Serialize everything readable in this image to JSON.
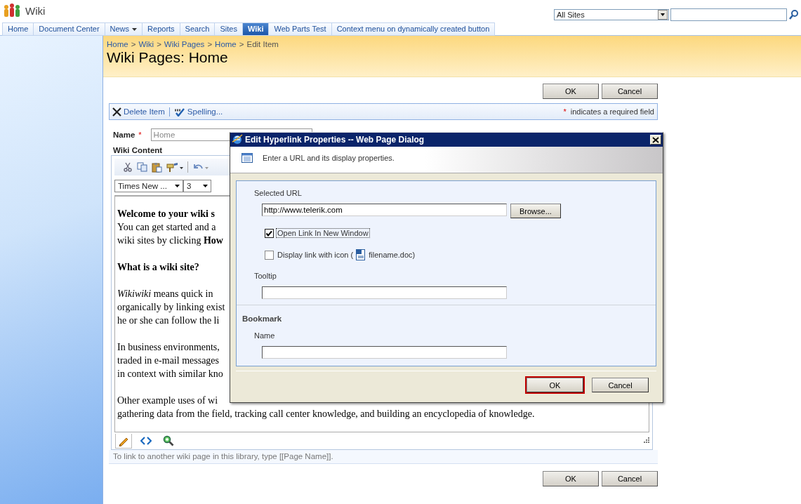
{
  "site": {
    "title": "Wiki"
  },
  "search": {
    "scope": "All Sites"
  },
  "nav_tabs": [
    {
      "label": "Home",
      "selected": false,
      "has_menu": false
    },
    {
      "label": "Document Center",
      "selected": false,
      "has_menu": false
    },
    {
      "label": "News",
      "selected": false,
      "has_menu": true
    },
    {
      "label": "Reports",
      "selected": false,
      "has_menu": false
    },
    {
      "label": "Search",
      "selected": false,
      "has_menu": false
    },
    {
      "label": "Sites",
      "selected": false,
      "has_menu": false
    },
    {
      "label": "Wiki",
      "selected": true,
      "has_menu": false
    },
    {
      "label": "Web Parts Test",
      "selected": false,
      "has_menu": false
    },
    {
      "label": "Context menu on dynamically created button",
      "selected": false,
      "has_menu": false
    }
  ],
  "breadcrumb": {
    "separator": ">",
    "items": [
      "Home",
      "Wiki",
      "Wiki Pages",
      "Home",
      "Edit Item"
    ]
  },
  "page_title": "Wiki Pages: Home",
  "top_buttons": [
    "OK",
    "Cancel"
  ],
  "toolbar": {
    "actions": [
      {
        "label": "Delete Item"
      },
      {
        "label": "Spelling..."
      }
    ],
    "required_mark": "*",
    "required_note": "indicates a required field"
  },
  "name_field": {
    "label": "Name",
    "required_mark": "*",
    "value": "Home"
  },
  "wiki_content": {
    "label": "Wiki Content",
    "font_name": "Times New ...",
    "font_size": "3",
    "paragraphs": [
      {
        "kind": "text",
        "lines": [
          "**Welcome to your wiki s**",
          "You can get started and a",
          "wiki sites by clicking **How**"
        ]
      },
      {
        "kind": "heading",
        "lines": [
          "What is a wiki site?"
        ]
      },
      {
        "kind": "text",
        "lines": [
          "*Wikiwiki* means quick in",
          "organically by linking exist",
          "he or she can follow the li"
        ]
      },
      {
        "kind": "text",
        "lines": [
          "In business environments,",
          "traded in e-mail messages",
          "in context with similar kno"
        ]
      },
      {
        "kind": "text",
        "lines": [
          "Other example uses of wi",
          "gathering data from the field, tracking call center knowledge, and building an encyclopedia of knowledge."
        ]
      }
    ],
    "modes": [
      {
        "selected": true
      },
      {
        "selected": false
      },
      {
        "selected": false
      }
    ],
    "hint": "To link to another wiki page in this library, type [[Page Name]]."
  },
  "bottom_buttons": [
    "OK",
    "Cancel"
  ],
  "dialog": {
    "title": "Edit Hyperlink Properties -- Web Page Dialog",
    "description": "Enter a URL and its display properties.",
    "url_label": "Selected URL",
    "url": "http://www.telerik.com",
    "browse": "Browse...",
    "options": [
      {
        "label": "Open Link In New Window",
        "checked": true,
        "focused": true
      },
      {
        "label": "Display link with icon (",
        "file": "filename.doc)",
        "checked": false,
        "focused": false
      }
    ],
    "tooltip_label": "Tooltip",
    "bookmark_heading": "Bookmark",
    "bookmark_name_label": "Name",
    "buttons": [
      {
        "label": "OK",
        "default": true
      },
      {
        "label": "Cancel",
        "default": false
      }
    ]
  }
}
